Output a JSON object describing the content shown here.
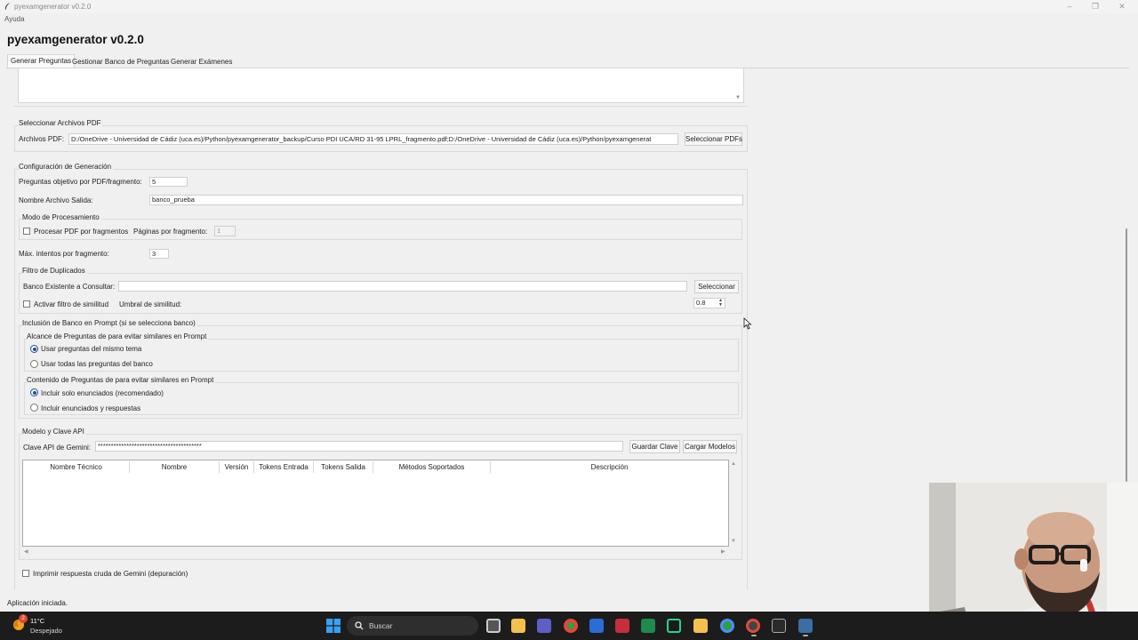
{
  "window": {
    "title": "pyexamgenerator v0.2.0",
    "menu": [
      "Ayuda"
    ],
    "app_title": "pyexamgenerator v0.2.0"
  },
  "tabs": [
    {
      "label": "Generar Preguntas",
      "active": true
    },
    {
      "label": "Gestionar Banco de Preguntas",
      "active": false
    },
    {
      "label": "Generar Exámenes",
      "active": false
    }
  ],
  "pdf_section": {
    "title": "Seleccionar Archivos PDF",
    "label": "Archivos PDF:",
    "value": "D:/OneDrive - Universidad de Cádiz (uca.es)/Python/pyexamgenerator_backup/Curso PDI UCA/RD 31-95 LPRL_fragmento.pdf;D:/OneDrive - Universidad de Cádiz (uca.es)/Python/pyexamgenerat",
    "button": "Seleccionar PDFs"
  },
  "config": {
    "title": "Configuración de Generación",
    "questions_label": "Preguntas objetivo por PDF/fragmento:",
    "questions_value": "5",
    "output_label": "Nombre Archivo Salida:",
    "output_value": "banco_prueba",
    "mode_title": "Modo de Procesamiento",
    "fragment_checkbox": "Procesar PDF por fragmentos",
    "pages_label": "Páginas por fragmento:",
    "pages_value": "1",
    "max_attempts_label": "Máx. intentos por fragmento:",
    "max_attempts_value": "3"
  },
  "duplicates": {
    "title": "Filtro de Duplicados",
    "bank_label": "Banco Existente a Consultar:",
    "bank_value": "",
    "select_button": "Seleccionar",
    "filter_checkbox": "Activar filtro de similitud",
    "threshold_label": "Umbral de similitud:",
    "threshold_value": "0.8"
  },
  "inclusion": {
    "title": "Inclusión de Banco en Prompt (si se selecciona banco)",
    "scope_title": "Alcance de Preguntas de para evitar similares en Prompt",
    "scope_options": [
      "Usar preguntas del mismo tema",
      "Usar todas las preguntas del banco"
    ],
    "scope_selected": 0,
    "content_title": "Contenido de Preguntas de para evitar similares en Prompt",
    "content_options": [
      "Incluir solo enunciados (recomendado)",
      "Incluir enunciados y respuestas"
    ],
    "content_selected": 0
  },
  "model": {
    "title": "Modelo y Clave API",
    "api_label": "Clave API de Gemini:",
    "api_value": "****************************************",
    "save_button": "Guardar Clave",
    "load_button": "Cargar Modelos",
    "columns": [
      "Nombre Técnico",
      "Nombre",
      "Versión",
      "Tokens Entrada",
      "Tokens Salida",
      "Métodos Soportados",
      "Descripción"
    ]
  },
  "debug_checkbox": "Imprimir respuesta cruda de Gemini (depuración)",
  "status": "Aplicación iniciada.",
  "taskbar": {
    "weather_temp": "11°C",
    "weather_desc": "Despejado",
    "weather_badge": "2",
    "search_placeholder": "Buscar"
  },
  "colors": {
    "accent": "#1f4e98",
    "taskbar": "#1c1c1c"
  }
}
